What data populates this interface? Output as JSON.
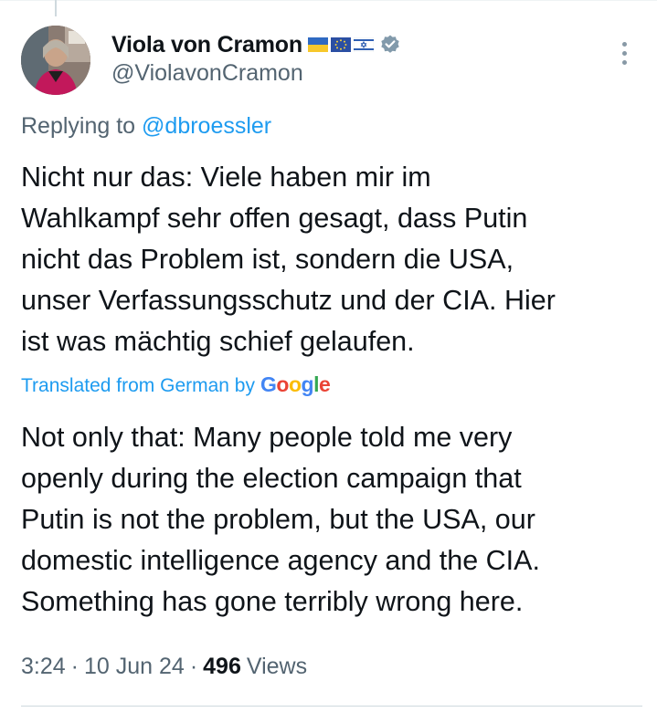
{
  "author": {
    "display_name": "Viola von Cramon",
    "handle": "@ViolavonCramon",
    "flags": [
      "ukraine-flag",
      "eu-flag",
      "israel-flag"
    ],
    "verified": true,
    "avatar_icon": "profile-avatar"
  },
  "reply": {
    "prefix": "Replying to ",
    "mention": "@dbroessler"
  },
  "tweet": {
    "text": "Nicht nur das: Viele haben mir im\nWahlkampf sehr offen gesagt, dass Putin\nnicht das Problem ist, sondern die USA,\nunser Verfassungsschutz und der CIA. Hier\nist was mächtig schief gelaufen."
  },
  "translation": {
    "label": "Translated from German by",
    "provider": "Google",
    "text": "Not only that: Many people told me very\nopenly during the election campaign that\nPutin is not the problem, but the USA, our\ndomestic intelligence agency and the CIA.\nSomething has gone terribly wrong here."
  },
  "meta": {
    "time": "3:24",
    "separator": "·",
    "date": "10 Jun 24",
    "views_count": "496",
    "views_label": "Views"
  },
  "colors": {
    "link": "#1d9bf0",
    "secondary_text": "#536471",
    "primary_text": "#0f1419",
    "verified_badge": "#829aab"
  }
}
